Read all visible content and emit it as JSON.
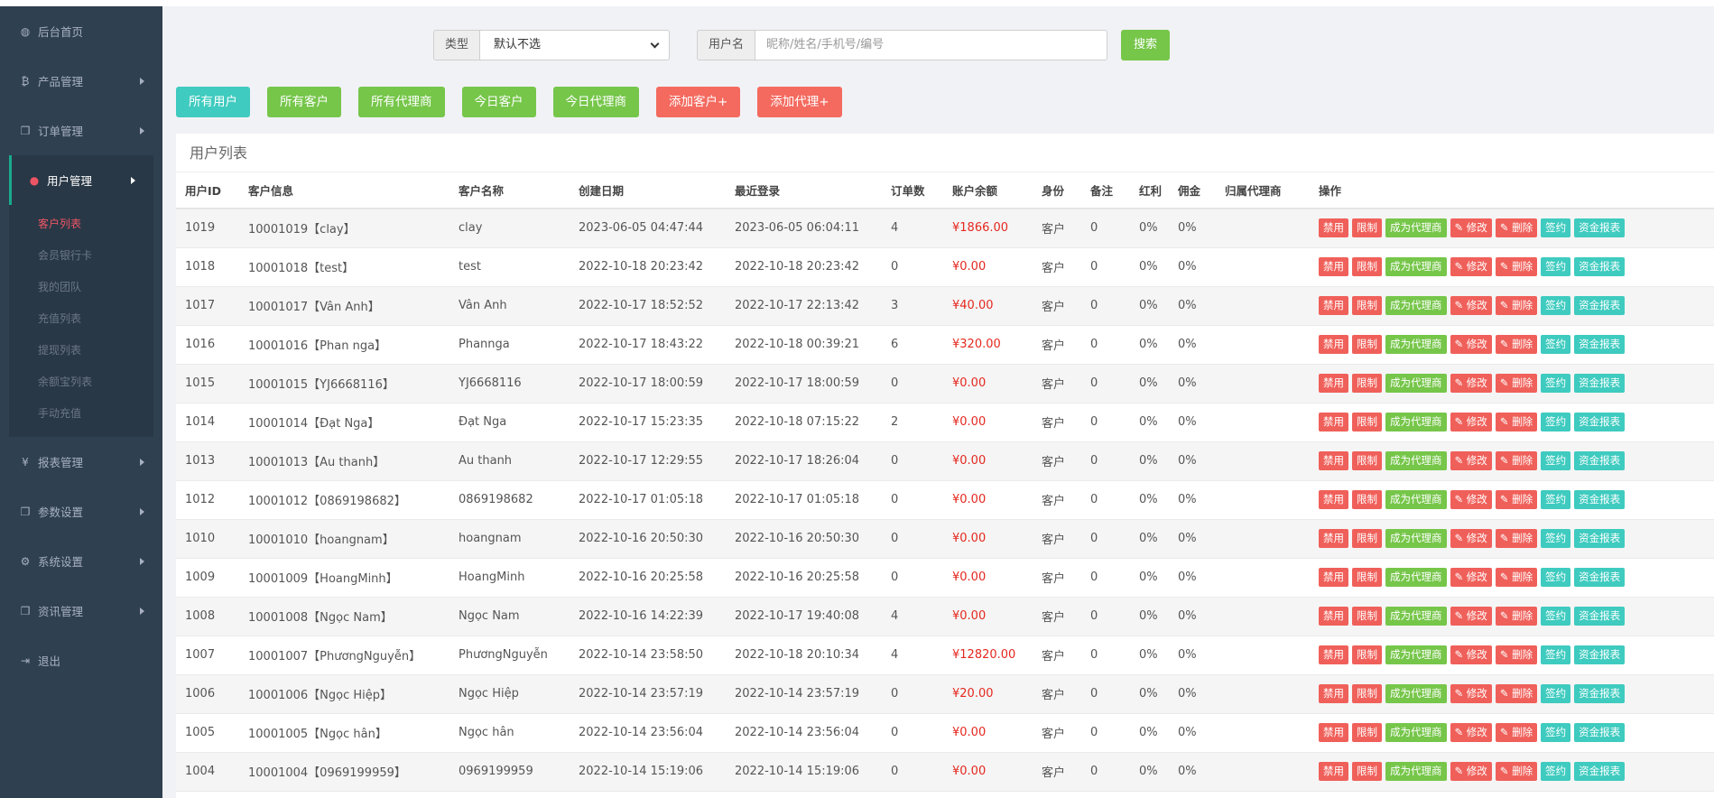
{
  "sidebar": {
    "items": [
      {
        "label": "后台首页",
        "icon": "dashboard-icon",
        "glyph": "◍",
        "arrow": false
      },
      {
        "label": "产品管理",
        "icon": "bitcoin-icon",
        "glyph": "₿",
        "arrow": true
      },
      {
        "label": "订单管理",
        "icon": "copy-icon",
        "glyph": "❐",
        "arrow": true
      },
      {
        "label": "用户管理",
        "icon": "user-icon",
        "glyph": "●",
        "arrow": true,
        "active": true
      },
      {
        "label": "报表管理",
        "icon": "yen-icon",
        "glyph": "¥",
        "arrow": true
      },
      {
        "label": "参数设置",
        "icon": "copy-icon",
        "glyph": "❐",
        "arrow": true
      },
      {
        "label": "系统设置",
        "icon": "gears-icon",
        "glyph": "⚙",
        "arrow": true
      },
      {
        "label": "资讯管理",
        "icon": "copy-icon",
        "glyph": "❐",
        "arrow": true
      },
      {
        "label": "退出",
        "icon": "sign-out-icon",
        "glyph": "⇥",
        "arrow": false
      }
    ],
    "sub_items": [
      "客户列表",
      "会员银行卡",
      "我的团队",
      "充值列表",
      "提现列表",
      "余额宝列表",
      "手动充值"
    ]
  },
  "filters": {
    "type_label": "类型",
    "type_selected": "默认不选",
    "username_label": "用户名",
    "username_placeholder": "昵称/姓名/手机号/编号",
    "search_label": "搜索"
  },
  "tabs": [
    {
      "label": "所有用户",
      "color": "#3fcbbf"
    },
    {
      "label": "所有客户",
      "color": "#76c64a"
    },
    {
      "label": "所有代理商",
      "color": "#76c64a"
    },
    {
      "label": "今日客户",
      "color": "#76c64a"
    },
    {
      "label": "今日代理商",
      "color": "#76c64a"
    },
    {
      "label": "添加客户+",
      "color": "#f46a5f"
    },
    {
      "label": "添加代理+",
      "color": "#f46a5f"
    }
  ],
  "panel_title": "用户列表",
  "columns": [
    "用户ID",
    "客户信息",
    "客户名称",
    "创建日期",
    "最近登录",
    "订单数",
    "账户余额",
    "身份",
    "备注",
    "红利",
    "佣金",
    "归属代理商",
    "操作"
  ],
  "actions": [
    "禁用",
    "限制",
    "成为代理商",
    "✎ 修改",
    "✎ 删除",
    "签约",
    "资金报表"
  ],
  "colors": {
    "sidebar_bg": "#2f4050",
    "accent_green": "#76c64a",
    "accent_teal": "#3fcbbf",
    "accent_red": "#f46a5f",
    "balance_red": "#e4281f"
  },
  "rows": [
    {
      "id": "1019",
      "info": "10001019【clay】",
      "name": "clay",
      "created": "2023-06-05 04:47:44",
      "login": "2023-06-05 06:04:11",
      "orders": "4",
      "balance": "¥1866.00",
      "role": "客户",
      "note": "0",
      "bonus": "0%",
      "commission": "0%",
      "agent": ""
    },
    {
      "id": "1018",
      "info": "10001018【test】",
      "name": "test",
      "created": "2022-10-18 20:23:42",
      "login": "2022-10-18 20:23:42",
      "orders": "0",
      "balance": "¥0.00",
      "role": "客户",
      "note": "0",
      "bonus": "0%",
      "commission": "0%",
      "agent": ""
    },
    {
      "id": "1017",
      "info": "10001017【Vân Anh】",
      "name": "Vân Anh",
      "created": "2022-10-17 18:52:52",
      "login": "2022-10-17 22:13:42",
      "orders": "3",
      "balance": "¥40.00",
      "role": "客户",
      "note": "0",
      "bonus": "0%",
      "commission": "0%",
      "agent": ""
    },
    {
      "id": "1016",
      "info": "10001016【Phan nga】",
      "name": "Phannga",
      "created": "2022-10-17 18:43:22",
      "login": "2022-10-18 00:39:21",
      "orders": "6",
      "balance": "¥320.00",
      "role": "客户",
      "note": "0",
      "bonus": "0%",
      "commission": "0%",
      "agent": ""
    },
    {
      "id": "1015",
      "info": "10001015【YJ6668116】",
      "name": "YJ6668116",
      "created": "2022-10-17 18:00:59",
      "login": "2022-10-17 18:00:59",
      "orders": "0",
      "balance": "¥0.00",
      "role": "客户",
      "note": "0",
      "bonus": "0%",
      "commission": "0%",
      "agent": ""
    },
    {
      "id": "1014",
      "info": "10001014【Đạt Nga】",
      "name": "Đạt Nga",
      "created": "2022-10-17 15:23:35",
      "login": "2022-10-18 07:15:22",
      "orders": "2",
      "balance": "¥0.00",
      "role": "客户",
      "note": "0",
      "bonus": "0%",
      "commission": "0%",
      "agent": ""
    },
    {
      "id": "1013",
      "info": "10001013【Au thanh】",
      "name": "Au thanh",
      "created": "2022-10-17 12:29:55",
      "login": "2022-10-17 18:26:04",
      "orders": "0",
      "balance": "¥0.00",
      "role": "客户",
      "note": "0",
      "bonus": "0%",
      "commission": "0%",
      "agent": ""
    },
    {
      "id": "1012",
      "info": "10001012【0869198682】",
      "name": "0869198682",
      "created": "2022-10-17 01:05:18",
      "login": "2022-10-17 01:05:18",
      "orders": "0",
      "balance": "¥0.00",
      "role": "客户",
      "note": "0",
      "bonus": "0%",
      "commission": "0%",
      "agent": ""
    },
    {
      "id": "1010",
      "info": "10001010【hoangnam】",
      "name": "hoangnam",
      "created": "2022-10-16 20:50:30",
      "login": "2022-10-16 20:50:30",
      "orders": "0",
      "balance": "¥0.00",
      "role": "客户",
      "note": "0",
      "bonus": "0%",
      "commission": "0%",
      "agent": ""
    },
    {
      "id": "1009",
      "info": "10001009【HoangMinh】",
      "name": "HoangMinh",
      "created": "2022-10-16 20:25:58",
      "login": "2022-10-16 20:25:58",
      "orders": "0",
      "balance": "¥0.00",
      "role": "客户",
      "note": "0",
      "bonus": "0%",
      "commission": "0%",
      "agent": ""
    },
    {
      "id": "1008",
      "info": "10001008【Ngọc Nam】",
      "name": "Ngọc Nam",
      "created": "2022-10-16 14:22:39",
      "login": "2022-10-17 19:40:08",
      "orders": "4",
      "balance": "¥0.00",
      "role": "客户",
      "note": "0",
      "bonus": "0%",
      "commission": "0%",
      "agent": ""
    },
    {
      "id": "1007",
      "info": "10001007【PhươngNguyễn】",
      "name": "PhươngNguyễn",
      "created": "2022-10-14 23:58:50",
      "login": "2022-10-18 20:10:34",
      "orders": "4",
      "balance": "¥12820.00",
      "role": "客户",
      "note": "0",
      "bonus": "0%",
      "commission": "0%",
      "agent": ""
    },
    {
      "id": "1006",
      "info": "10001006【Ngọc Hiệp】",
      "name": "Ngọc Hiệp",
      "created": "2022-10-14 23:57:19",
      "login": "2022-10-14 23:57:19",
      "orders": "0",
      "balance": "¥20.00",
      "role": "客户",
      "note": "0",
      "bonus": "0%",
      "commission": "0%",
      "agent": ""
    },
    {
      "id": "1005",
      "info": "10001005【Ngọc hân】",
      "name": "Ngọc hân",
      "created": "2022-10-14 23:56:04",
      "login": "2022-10-14 23:56:04",
      "orders": "0",
      "balance": "¥0.00",
      "role": "客户",
      "note": "0",
      "bonus": "0%",
      "commission": "0%",
      "agent": ""
    },
    {
      "id": "1004",
      "info": "10001004【0969199959】",
      "name": "0969199959",
      "created": "2022-10-14 15:19:06",
      "login": "2022-10-14 15:19:06",
      "orders": "0",
      "balance": "¥0.00",
      "role": "客户",
      "note": "0",
      "bonus": "0%",
      "commission": "0%",
      "agent": ""
    }
  ]
}
